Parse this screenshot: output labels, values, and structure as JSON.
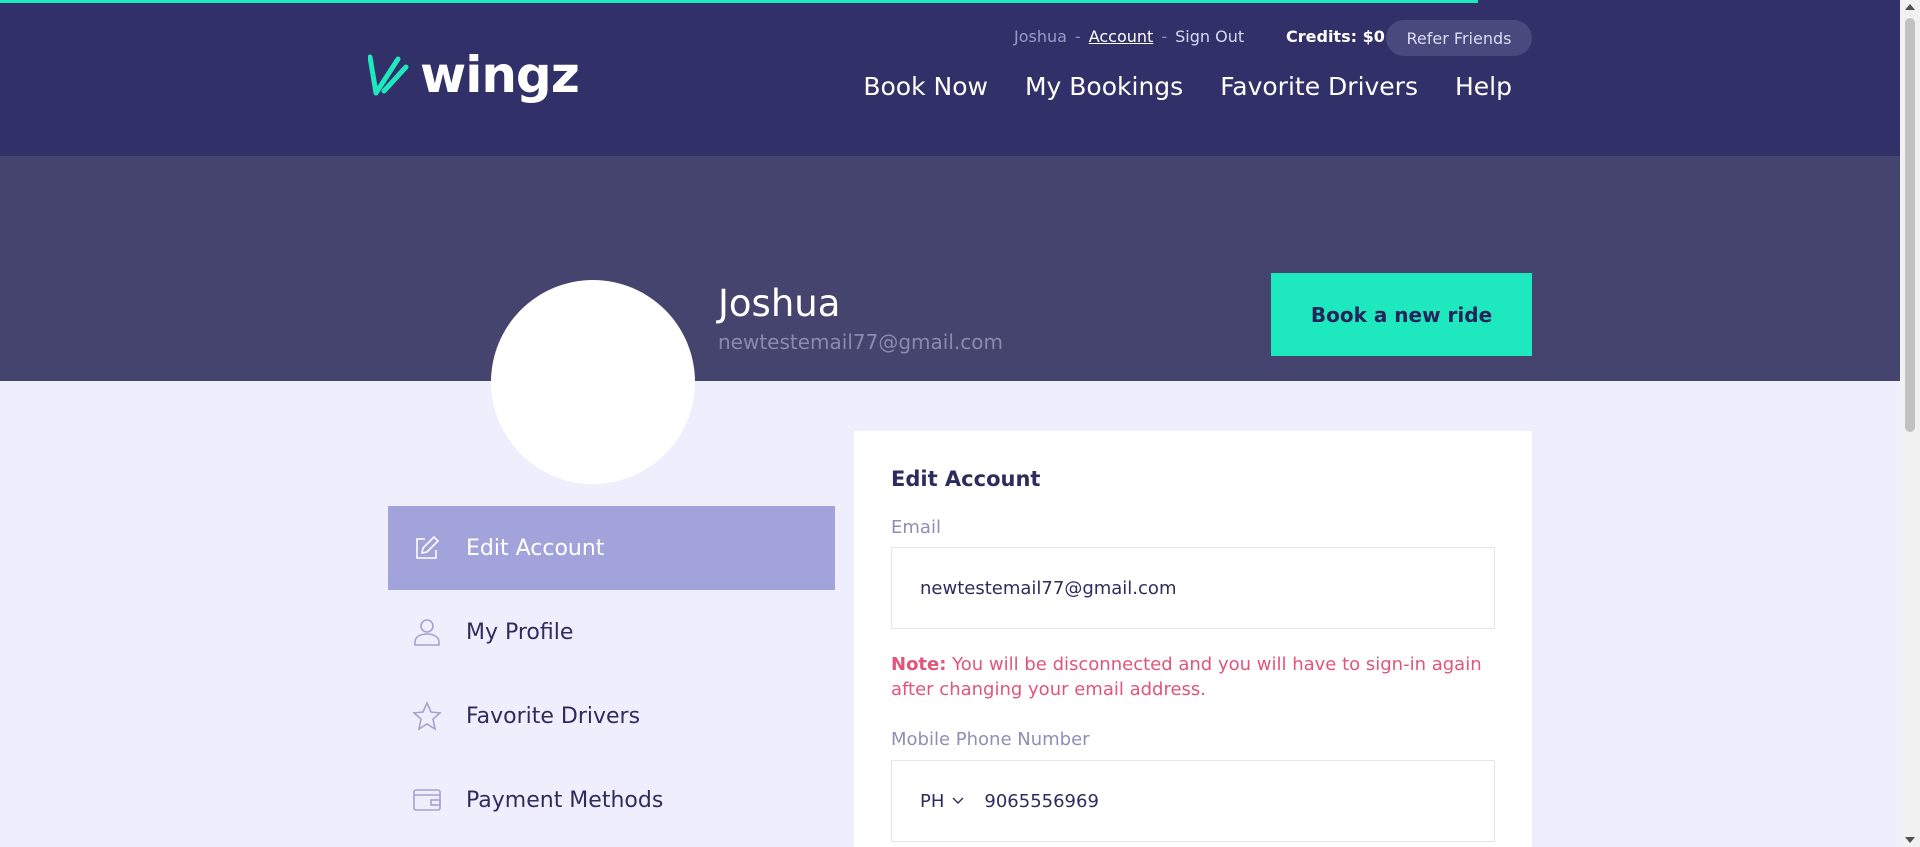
{
  "colors": {
    "header_bg": "#313068",
    "hero_bg": "#45446e",
    "accent": "#1ee8bd",
    "page_bg": "#efeefd",
    "active_menu_bg": "#a3a3dc",
    "note_color": "#e0557a"
  },
  "page_progress_percent": 77,
  "brand": {
    "logo_text": "wingz",
    "logo_icon": "wingz-logo-icon"
  },
  "user_nav": {
    "username": "Joshua",
    "separator": "-",
    "account_link": "Account",
    "sign_out": "Sign Out",
    "credits": "Credits: $0",
    "refer_button": "Refer Friends"
  },
  "main_nav": [
    "Book Now",
    "My Bookings",
    "Favorite Drivers",
    "Help"
  ],
  "profile": {
    "name": "Joshua",
    "email": "newtestemail77@gmail.com",
    "book_button": "Book a new ride"
  },
  "side_menu": [
    {
      "label": "Edit Account",
      "icon": "edit-icon",
      "active": true
    },
    {
      "label": "My Profile",
      "icon": "user-icon",
      "active": false
    },
    {
      "label": "Favorite Drivers",
      "icon": "star-icon",
      "active": false
    },
    {
      "label": "Payment Methods",
      "icon": "wallet-icon",
      "active": false
    }
  ],
  "edit_account": {
    "title": "Edit Account",
    "email_label": "Email",
    "email_value": "newtestemail77@gmail.com",
    "note_prefix": "Note:",
    "note_text": " You will be disconnected and you will have to sign-in again after changing your email address.",
    "phone_label": "Mobile Phone Number",
    "country_code": "PH",
    "phone_value": "9065556969"
  }
}
